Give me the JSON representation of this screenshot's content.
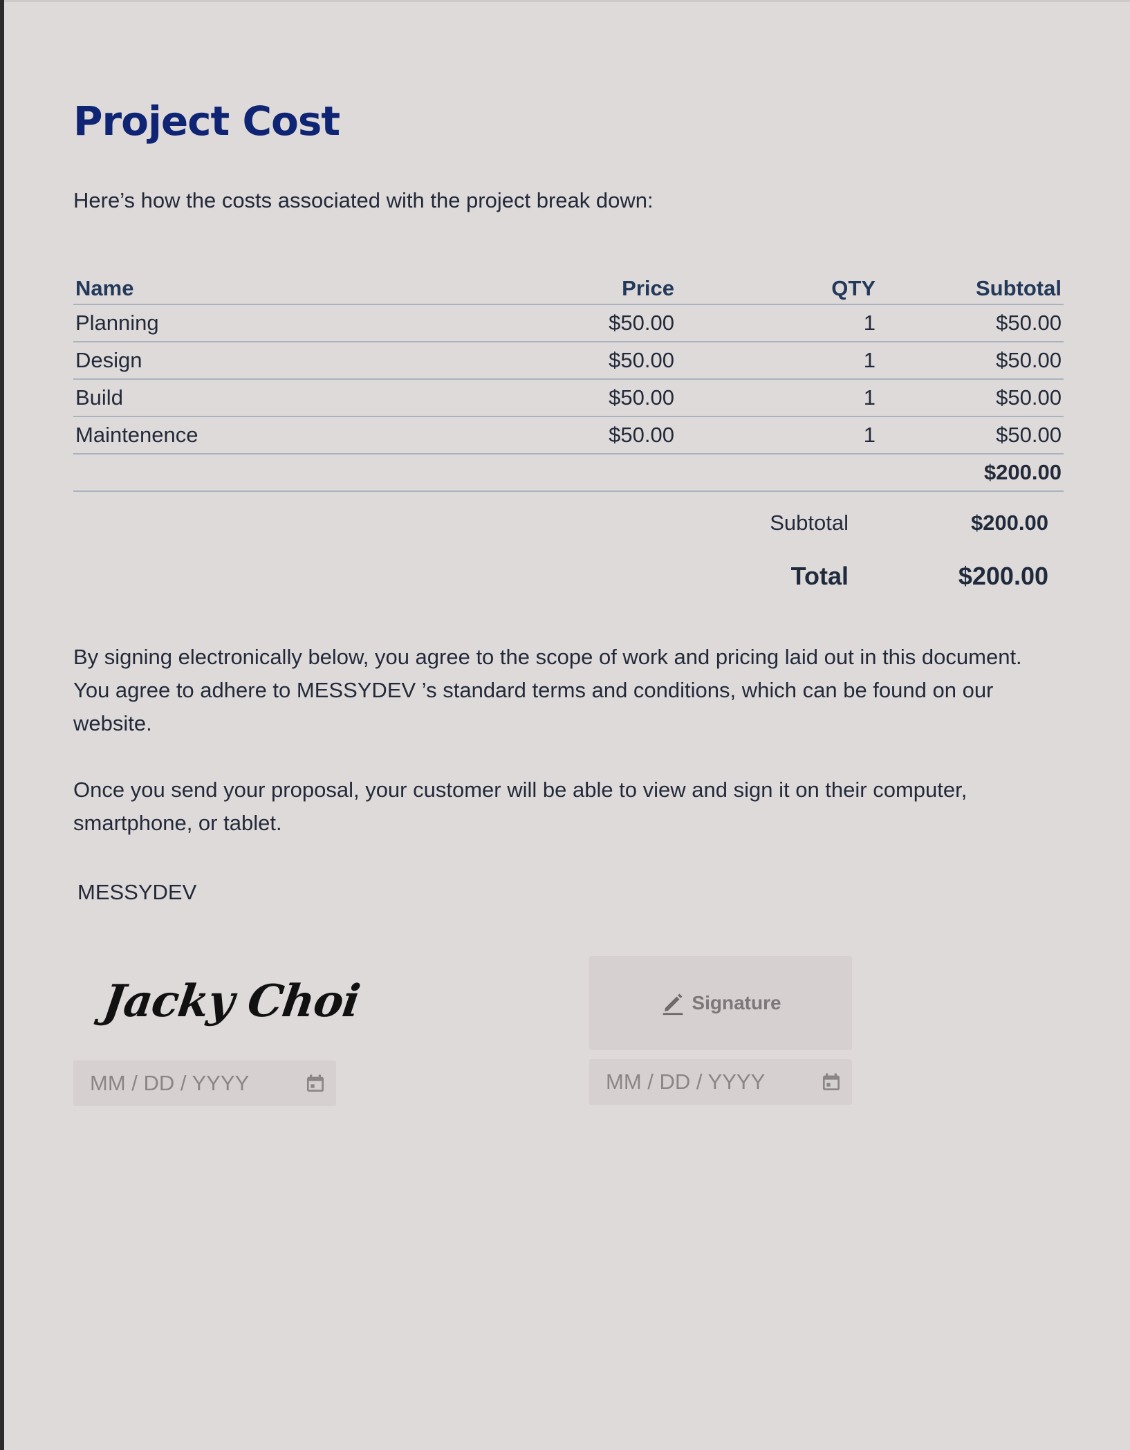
{
  "title": "Project Cost",
  "intro": "Here’s how the costs associated with the project break down:",
  "table": {
    "headers": {
      "name": "Name",
      "price": "Price",
      "qty": "QTY",
      "subtotal": "Subtotal"
    },
    "rows": [
      {
        "name": "Planning",
        "price": "$50.00",
        "qty": "1",
        "subtotal": "$50.00"
      },
      {
        "name": "Design",
        "price": "$50.00",
        "qty": "1",
        "subtotal": "$50.00"
      },
      {
        "name": "Build",
        "price": "$50.00",
        "qty": "1",
        "subtotal": "$50.00"
      },
      {
        "name": "Maintenence",
        "price": "$50.00",
        "qty": "1",
        "subtotal": "$50.00"
      }
    ],
    "table_total": "$200.00"
  },
  "summary": {
    "subtotal_label": "Subtotal",
    "subtotal_value": "$200.00",
    "total_label": "Total",
    "total_value": "$200.00"
  },
  "paragraphs": {
    "p1_line1": "By signing electronically below, you agree to the scope of work and pricing laid out in this document.",
    "p1_line2": "You agree to adhere to  MESSYDEV ’s standard terms and conditions, which can be found on our",
    "p1_line3": "website.",
    "p2_line1": "Once you send your proposal, your customer will be able to view and sign it on their computer,",
    "p2_line2": "smartphone, or tablet."
  },
  "company": "MESSYDEV",
  "signatures": {
    "left_signature": "Jacky Choi",
    "left_date_placeholder": "MM / DD / YYYY",
    "right_button_label": "Signature",
    "right_date_placeholder": "MM / DD / YYYY"
  },
  "icons": {
    "calendar": "calendar-icon",
    "pen": "pen-icon"
  },
  "colors": {
    "page_background": "#dfdada",
    "title": "#0f2473",
    "table_header": "#22395a",
    "field_background": "#d6d0d0"
  }
}
